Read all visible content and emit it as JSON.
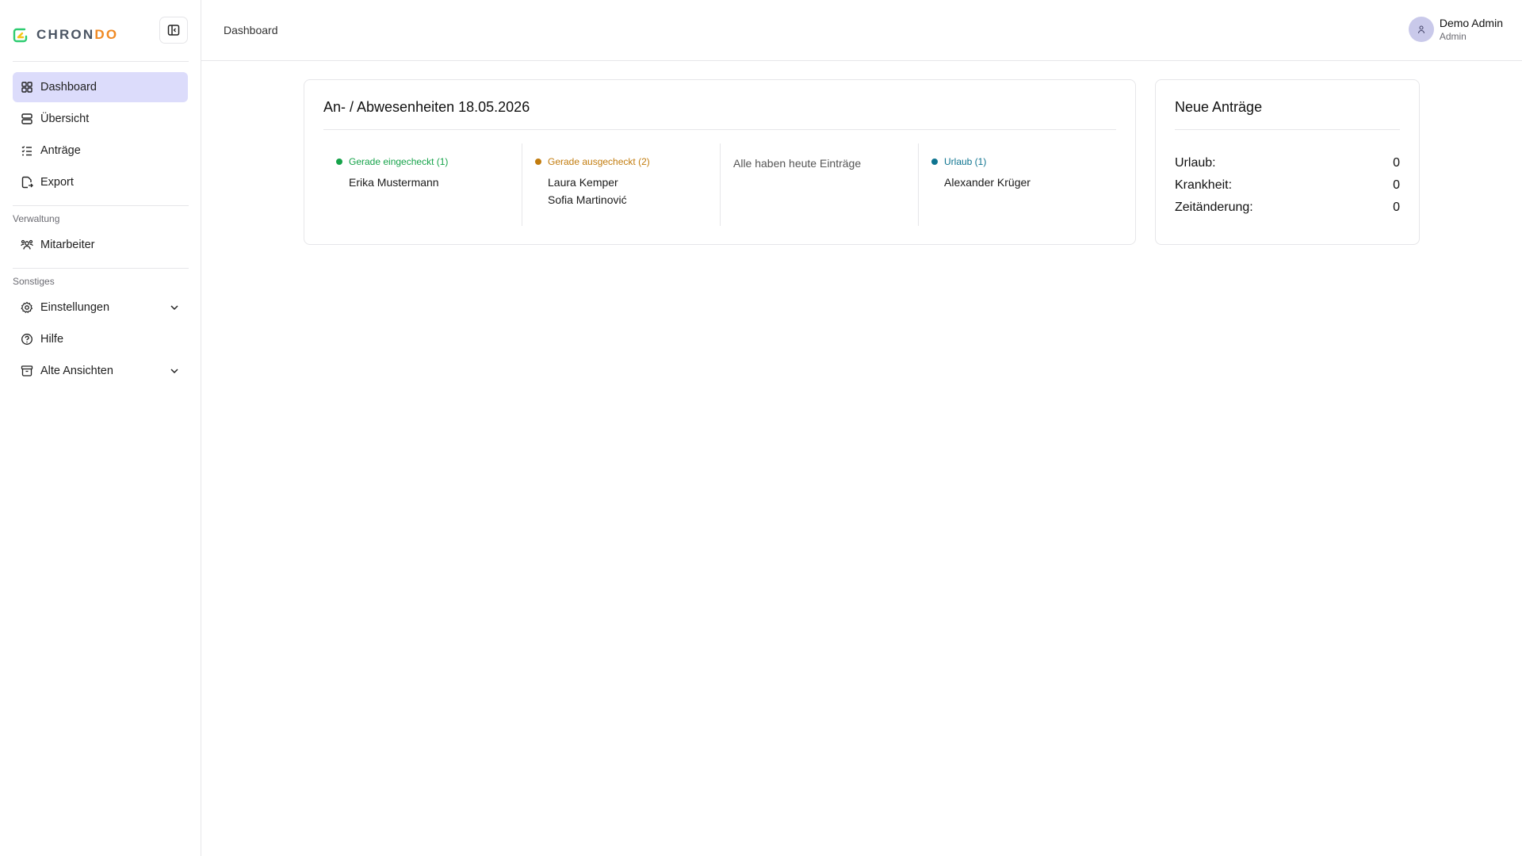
{
  "brand": {
    "part1": "CHRON",
    "part2": "DO",
    "accent": "#f08a24",
    "mark_color": "#22c55e"
  },
  "sidebar": {
    "main_items": [
      {
        "label": "Dashboard",
        "icon": "grid-icon",
        "active": true
      },
      {
        "label": "Übersicht",
        "icon": "server-icon"
      },
      {
        "label": "Anträge",
        "icon": "list-check-icon"
      },
      {
        "label": "Export",
        "icon": "file-export-icon"
      }
    ],
    "section_admin": "Verwaltung",
    "admin_items": [
      {
        "label": "Mitarbeiter",
        "icon": "users-icon"
      }
    ],
    "section_other": "Sonstiges",
    "other_items": [
      {
        "label": "Einstellungen",
        "icon": "gear-icon",
        "expandable": true
      },
      {
        "label": "Hilfe",
        "icon": "help-circle-icon"
      },
      {
        "label": "Alte Ansichten",
        "icon": "archive-icon",
        "expandable": true
      }
    ]
  },
  "header": {
    "breadcrumb": "Dashboard",
    "user_name": "Demo Admin",
    "user_role": "Admin"
  },
  "attendance": {
    "title": "An- / Abwesenheiten 18.05.2026",
    "checked_in": {
      "label": "Gerade eingecheckt (1)",
      "color": "#16a34a",
      "names": [
        "Erika Mustermann"
      ]
    },
    "checked_out": {
      "label": "Gerade ausgecheckt (2)",
      "color": "#c27c0e",
      "names": [
        "Laura Kemper",
        "Sofia Martinović"
      ]
    },
    "entries_text": "Alle haben heute Einträge",
    "vacation": {
      "label": "Urlaub (1)",
      "color": "#0e7490",
      "names": [
        "Alexander Krüger"
      ]
    }
  },
  "requests": {
    "title": "Neue Anträge",
    "rows": [
      {
        "label": "Urlaub:",
        "value": "0"
      },
      {
        "label": "Krankheit:",
        "value": "0"
      },
      {
        "label": "Zeitänderung:",
        "value": "0"
      }
    ]
  }
}
